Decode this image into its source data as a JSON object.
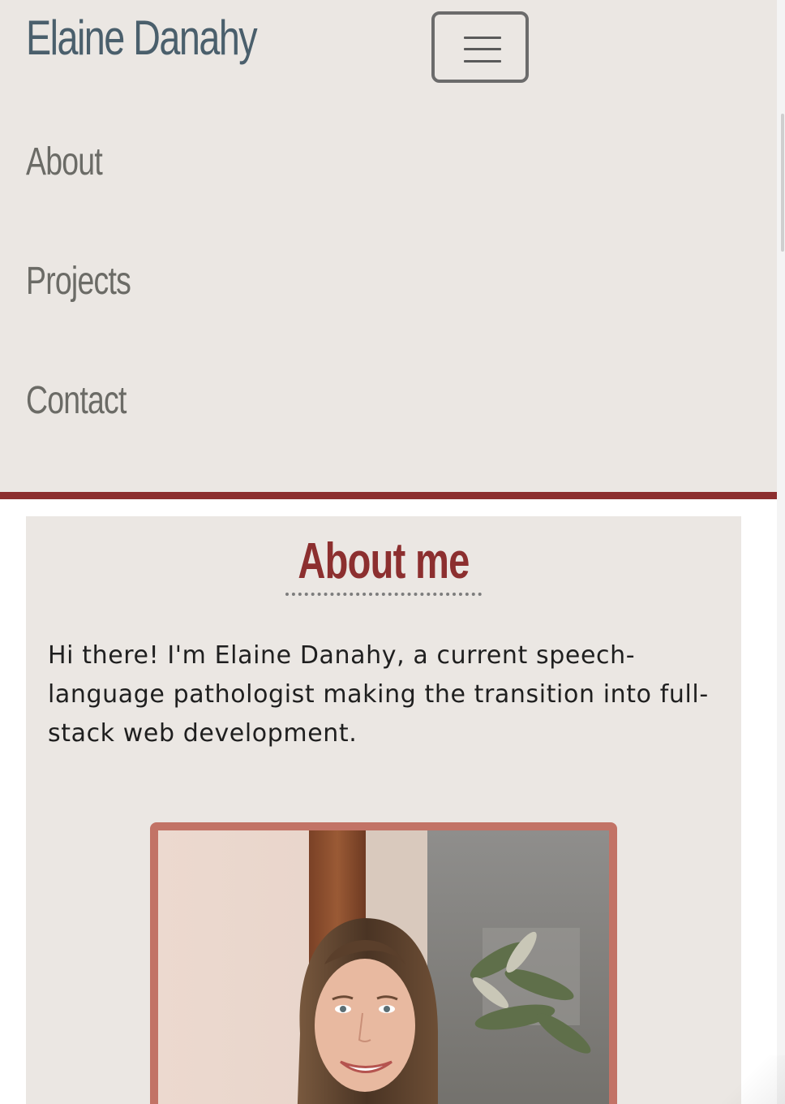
{
  "header": {
    "brand": "Elaine Danahy",
    "nav_items": [
      {
        "label": "About"
      },
      {
        "label": "Projects"
      },
      {
        "label": "Contact"
      }
    ]
  },
  "about": {
    "title": "About me",
    "text": "Hi there! I'm Elaine Danahy, a current speech-language pathologist making the transition into full-stack web development."
  },
  "colors": {
    "navbar_bg": "#ebe7e3",
    "brand": "#4a5f6c",
    "accent_red": "#8c2f2f",
    "photo_border": "#c27366"
  },
  "icons": {
    "toggler": "hamburger-menu-icon"
  }
}
